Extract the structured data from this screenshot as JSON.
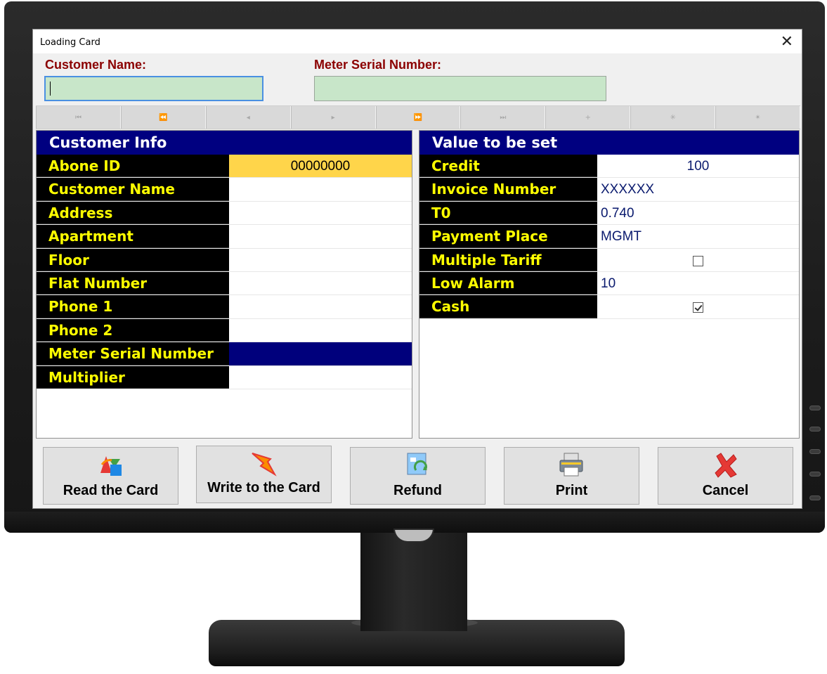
{
  "window": {
    "title": "Loading Card"
  },
  "header": {
    "customer_name_label": "Customer Name:",
    "meter_serial_label": "Meter Serial Number:",
    "customer_name_value": "",
    "meter_serial_value": ""
  },
  "nav": {
    "buttons": [
      "first",
      "prev-page",
      "prev",
      "next",
      "next-page",
      "last",
      "add",
      "post",
      "cancel-edit"
    ]
  },
  "customer_info": {
    "header": "Customer Info",
    "rows": [
      {
        "label": "Abone ID",
        "value": "00000000"
      },
      {
        "label": "Customer Name",
        "value": ""
      },
      {
        "label": "Address",
        "value": ""
      },
      {
        "label": "Apartment",
        "value": ""
      },
      {
        "label": "Floor",
        "value": ""
      },
      {
        "label": "Flat Number",
        "value": ""
      },
      {
        "label": "Phone 1",
        "value": ""
      },
      {
        "label": "Phone 2",
        "value": ""
      },
      {
        "label": "Meter Serial Number",
        "value": ""
      },
      {
        "label": "Multiplier",
        "value": ""
      }
    ]
  },
  "value_to_set": {
    "header": "Value to be set",
    "rows": [
      {
        "label": "Credit",
        "value": "100"
      },
      {
        "label": "Invoice Number",
        "value": "XXXXXX"
      },
      {
        "label": "T0",
        "value": "0.740"
      },
      {
        "label": "Payment Place",
        "value": "MGMT"
      },
      {
        "label": "Multiple Tariff",
        "value": "",
        "checked": false
      },
      {
        "label": "Low Alarm",
        "value": "10"
      },
      {
        "label": "Cash",
        "value": "",
        "checked": true
      }
    ]
  },
  "actions": {
    "read": "Read the Card",
    "write": "Write to the Card",
    "refund": "Refund",
    "print": "Print",
    "cancel": "Cancel"
  },
  "colors": {
    "header_bg": "#000080",
    "label_bg": "#000000",
    "label_text": "#ffff00",
    "field_bg": "#c8e6c9",
    "abone_bg": "#ffd54a",
    "caption_red": "#8b0000"
  }
}
